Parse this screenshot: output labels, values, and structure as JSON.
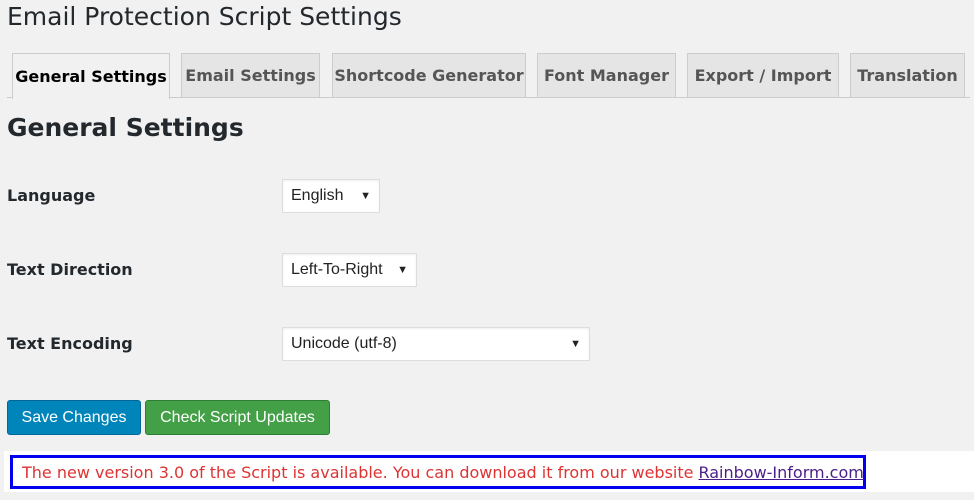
{
  "page_title": "Email Protection Script Settings",
  "tabs": [
    {
      "label": "General Settings",
      "active": true
    },
    {
      "label": "Email Settings"
    },
    {
      "label": "Shortcode Generator"
    },
    {
      "label": "Font Manager"
    },
    {
      "label": "Export / Import"
    },
    {
      "label": "Translation"
    }
  ],
  "section_title": "General Settings",
  "fields": {
    "language": {
      "label": "Language",
      "value": "English"
    },
    "text_direction": {
      "label": "Text Direction",
      "value": "Left-To-Right"
    },
    "text_encoding": {
      "label": "Text Encoding",
      "value": "Unicode (utf-8)"
    }
  },
  "buttons": {
    "save": "Save Changes",
    "check": "Check Script Updates"
  },
  "notice": {
    "text": "The new version 3.0 of the Script is available. You can download it from our website",
    "link": "Rainbow-Inform.com"
  },
  "colors": {
    "save": "#0085ba",
    "check": "#43a047",
    "notice_text": "#dd3333",
    "notice_border": "#0000f0"
  }
}
